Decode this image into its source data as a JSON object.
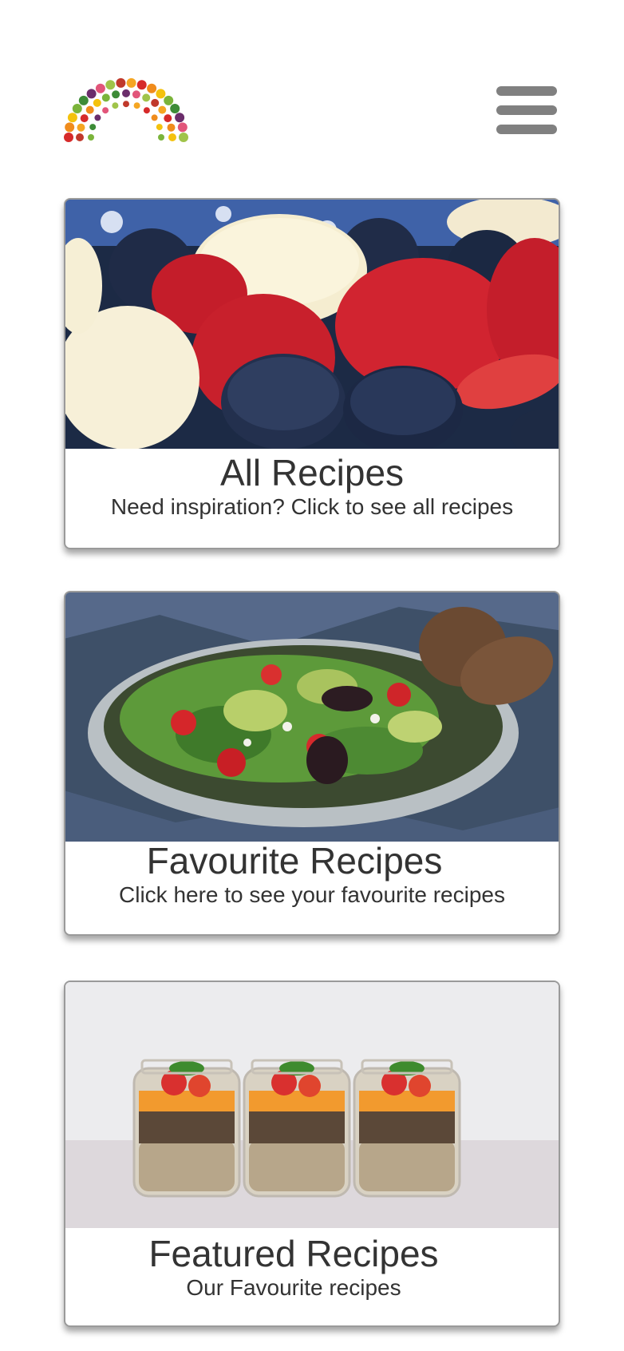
{
  "header": {
    "logo_icon": "fruit-vegetable-rainbow-logo",
    "menu_icon": "hamburger-menu-icon"
  },
  "cards": [
    {
      "title": "All Recipes",
      "subtitle": "Need inspiration? Click to see all recipes",
      "image": "fruit-bowl-photo"
    },
    {
      "title": "Favourite Recipes",
      "subtitle": "Click here to see your favourite recipes",
      "image": "salad-bowl-photo"
    },
    {
      "title": "Featured Recipes",
      "subtitle": "Our Favourite recipes",
      "image": "mason-jar-meals-photo"
    }
  ],
  "colors": {
    "menu_icon": "#808080",
    "text": "#333333",
    "card_border": "#9a9a9a"
  }
}
